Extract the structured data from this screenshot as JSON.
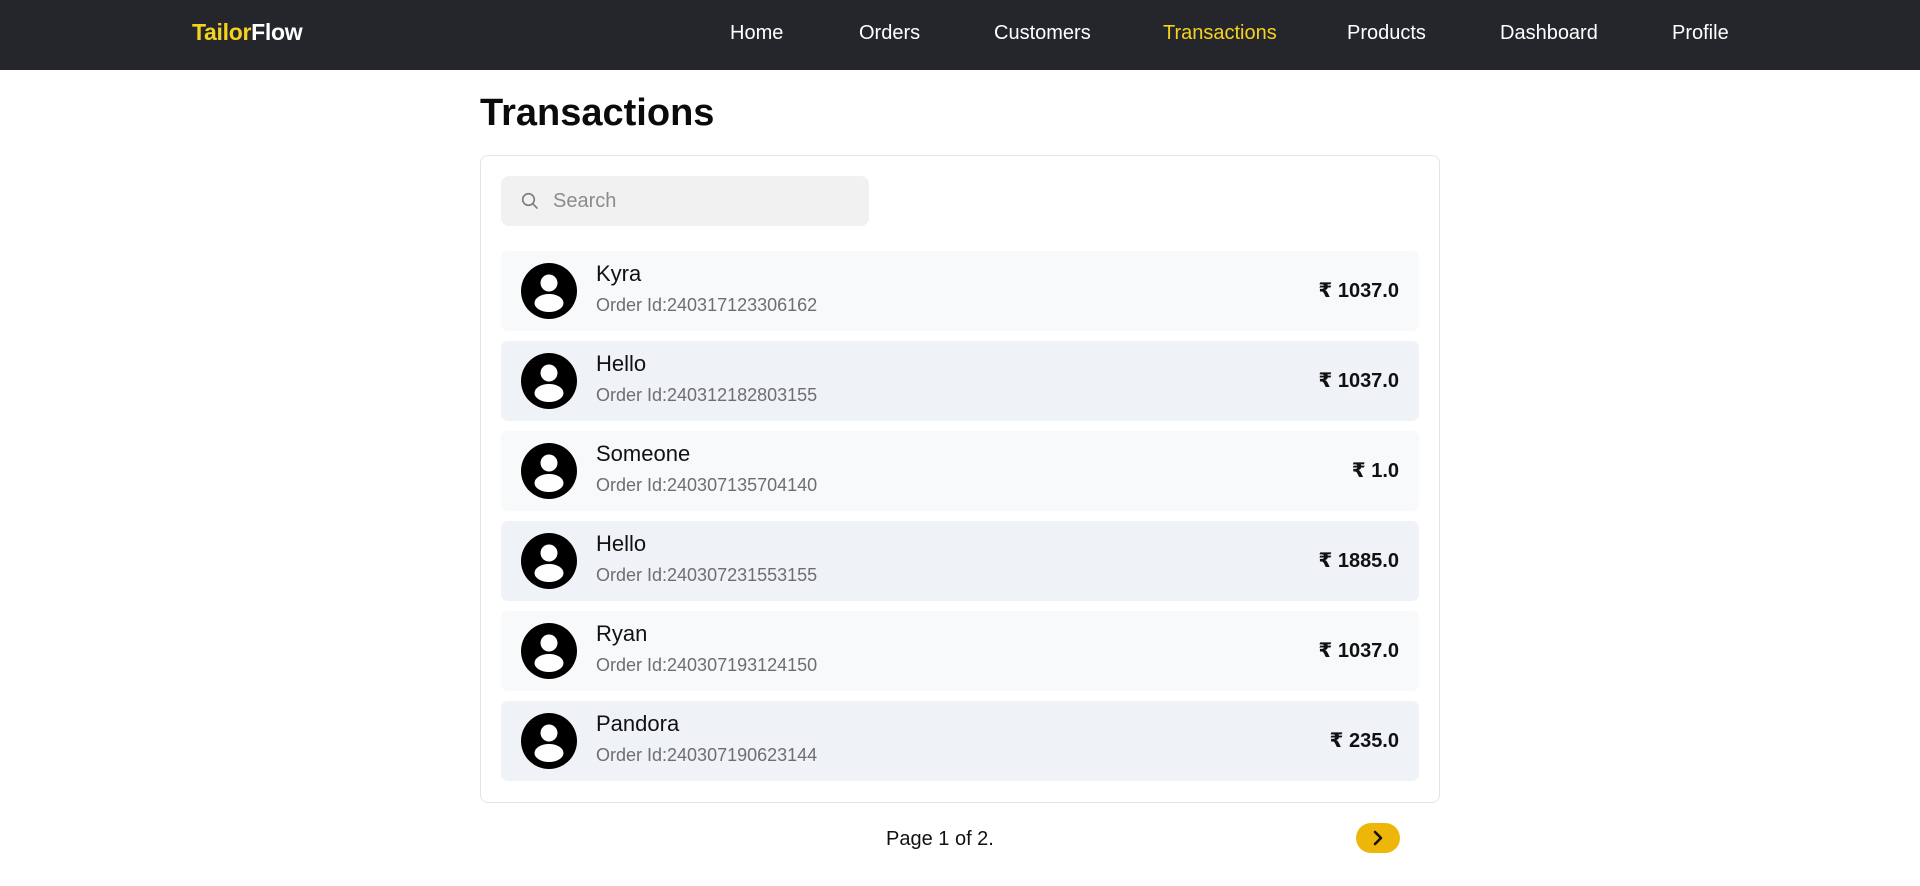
{
  "brand": {
    "part1": "Tailor",
    "part2": "Flow"
  },
  "nav": [
    {
      "label": "Home"
    },
    {
      "label": "Orders"
    },
    {
      "label": "Customers"
    },
    {
      "label": "Transactions"
    },
    {
      "label": "Products"
    },
    {
      "label": "Dashboard"
    },
    {
      "label": "Profile"
    }
  ],
  "colors": {
    "nav_bg": "#25262b",
    "accent": "#f5d21f",
    "button": "#efb60a"
  },
  "page_title": "Transactions",
  "search": {
    "placeholder": "Search",
    "value": "",
    "icon": "search-icon"
  },
  "transactions": [
    {
      "name": "Kyra",
      "order_id": "Order Id:240317123306162",
      "amount": "₹ 1037.0"
    },
    {
      "name": "Hello",
      "order_id": "Order Id:240312182803155",
      "amount": "₹ 1037.0"
    },
    {
      "name": "Someone",
      "order_id": "Order Id:240307135704140",
      "amount": "₹ 1.0"
    },
    {
      "name": "Hello",
      "order_id": "Order Id:240307231553155",
      "amount": "₹ 1885.0"
    },
    {
      "name": "Ryan",
      "order_id": "Order Id:240307193124150",
      "amount": "₹ 1037.0"
    },
    {
      "name": "Pandora",
      "order_id": "Order Id:240307190623144",
      "amount": "₹ 235.0"
    }
  ],
  "pagination": {
    "text": "Page 1 of 2.",
    "next_icon": "chevron-right-icon"
  }
}
